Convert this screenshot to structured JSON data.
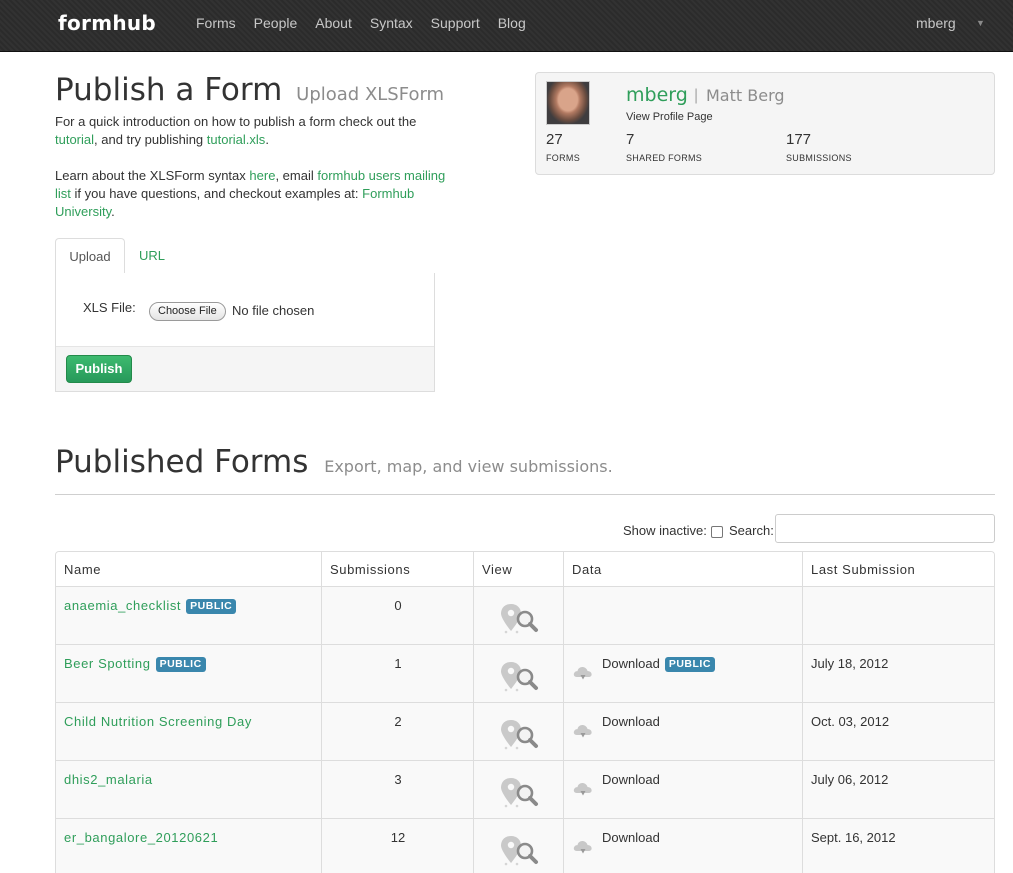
{
  "navbar": {
    "brand": "formhub",
    "links": [
      "Forms",
      "People",
      "About",
      "Syntax",
      "Support",
      "Blog"
    ],
    "user": "mberg"
  },
  "publish": {
    "title": "Publish a Form",
    "subtitle": "Upload XLSForm",
    "intro_text_1": "For a quick introduction on how to publish a form check out the",
    "intro_link_1": "tutorial",
    "intro_text_2": ", and try publishing",
    "intro_link_2": "tutorial.xls",
    "intro_text_3": ".",
    "learn_text_1": "Learn about the XLSForm syntax",
    "learn_link_1": "here",
    "learn_text_2": ", email",
    "learn_link_2": "formhub users mailing list",
    "learn_text_3": "if you have questions, and checkout examples at:",
    "learn_link_3": "Formhub University",
    "learn_text_4": ".",
    "tabs": [
      "Upload",
      "URL"
    ],
    "file_label": "XLS File:",
    "choose_file": "Choose File",
    "no_file": "No file chosen",
    "publish_button": "Publish"
  },
  "profile": {
    "username": "mberg",
    "separator": "|",
    "full_name": "Matt Berg",
    "profile_link": "View Profile Page",
    "stats": [
      {
        "value": "27",
        "label": "FORMS"
      },
      {
        "value": "7",
        "label": "SHARED FORMS"
      },
      {
        "value": "177",
        "label": "SUBMISSIONS"
      }
    ]
  },
  "published": {
    "title": "Published Forms",
    "subtitle": "Export, map, and view submissions.",
    "show_inactive_label": "Show inactive:",
    "search_label": "Search:",
    "search_value": "",
    "columns": [
      "Name",
      "Submissions",
      "View",
      "Data",
      "Last Submission"
    ],
    "rows": [
      {
        "name": "anaemia_checklist",
        "badge": "PUBLIC",
        "submissions": "0",
        "download": "",
        "data_badge": "",
        "last": ""
      },
      {
        "name": "Beer Spotting",
        "badge": "PUBLIC",
        "submissions": "1",
        "download": "Download",
        "data_badge": "PUBLIC",
        "last": "July 18, 2012"
      },
      {
        "name": "Child Nutrition Screening Day",
        "badge": "",
        "submissions": "2",
        "download": "Download",
        "data_badge": "",
        "last": "Oct. 03, 2012"
      },
      {
        "name": "dhis2_malaria",
        "badge": "",
        "submissions": "3",
        "download": "Download",
        "data_badge": "",
        "last": "July 06, 2012"
      },
      {
        "name": "er_bangalore_20120621",
        "badge": "",
        "submissions": "12",
        "download": "Download",
        "data_badge": "",
        "last": "Sept. 16, 2012"
      }
    ]
  },
  "icons": {
    "map": "map-search-icon",
    "cloud": "cloud-download-icon",
    "checkbox": "checkbox-icon",
    "caret": "caret-down-icon"
  },
  "colors": {
    "accent": "#2f9e5a",
    "badge": "#3a87ad",
    "navbar": "#2b2b2b"
  }
}
